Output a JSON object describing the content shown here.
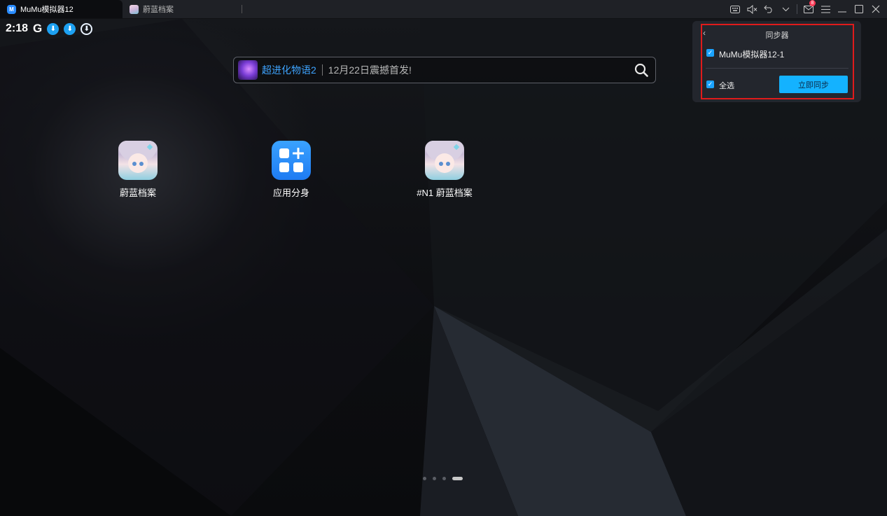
{
  "titlebar": {
    "tabs": [
      {
        "label": "MuMu模拟器12",
        "icon": "mumu-logo-icon",
        "active": true
      },
      {
        "label": "蔚蓝档案",
        "icon": "game-thumbnail-icon",
        "active": false
      }
    ],
    "mail_badge_count": "8",
    "icons": [
      "keyboard-icon",
      "mute-icon",
      "undo-icon",
      "chevron-down-icon",
      "mail-icon",
      "menu-icon",
      "minimize-icon",
      "maximize-icon",
      "close-icon"
    ]
  },
  "status_bar": {
    "time": "2:18",
    "g_letter": "G",
    "icons": [
      "google-icon",
      "download-icon",
      "download-icon",
      "download-outline-icon"
    ]
  },
  "search": {
    "game_name": "超进化物语2",
    "promo_text": "12月22日震撼首发!",
    "icon": "search-icon"
  },
  "apps": [
    {
      "label": "蔚蓝档案",
      "icon": "blue-archive-icon"
    },
    {
      "label": "应用分身",
      "icon": "app-clone-icon"
    },
    {
      "label": "#N1 蔚蓝档案",
      "icon": "blue-archive-icon"
    }
  ],
  "pagination": {
    "pages": 4,
    "current": 4
  },
  "sync_panel": {
    "title": "同步器",
    "back_glyph": "‹",
    "device_label": "MuMu模拟器12-1",
    "device_checked": true,
    "select_all_label": "全选",
    "select_all_checked": true,
    "sync_button_label": "立即同步"
  },
  "colors": {
    "accent": "#14b2ff",
    "highlight_border": "#e01b1b",
    "promo_link": "#3ea4ff",
    "badge": "#ff3b57"
  }
}
